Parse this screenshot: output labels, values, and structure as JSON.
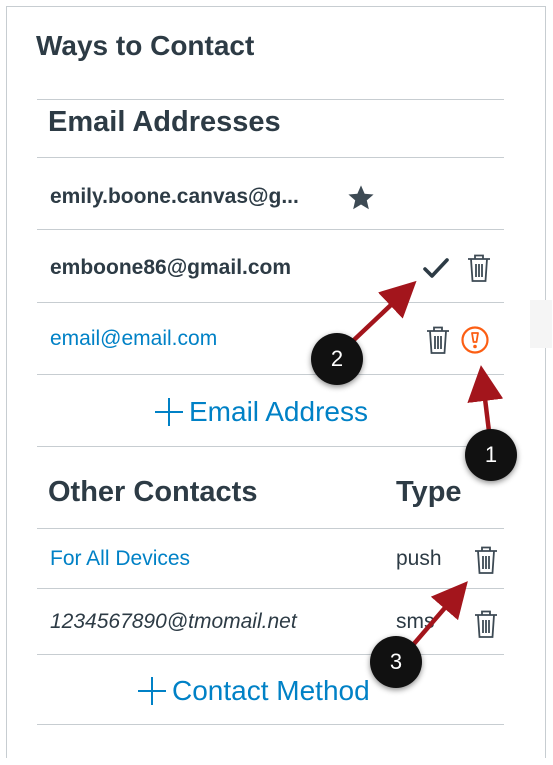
{
  "panel": {
    "title": "Ways to Contact"
  },
  "email_section": {
    "header": "Email Addresses",
    "items": [
      {
        "address": "emily.boone.canvas@g...",
        "status": "default",
        "icon": "star-icon"
      },
      {
        "address": "emboone86@gmail.com",
        "status": "confirmed",
        "icon": "checkmark-icon"
      },
      {
        "address": "email@email.com",
        "status": "unconfirmed",
        "icon": "alert-icon"
      }
    ],
    "add_label": "Email Address"
  },
  "other_section": {
    "header": "Other Contacts",
    "type_header": "Type",
    "items": [
      {
        "name": "For All Devices",
        "type": "push"
      },
      {
        "name": "1234567890@tmomail.net",
        "type": "sms"
      }
    ],
    "add_label": "Contact Method"
  },
  "callouts": [
    "1",
    "2",
    "3"
  ],
  "colors": {
    "link": "#0081c6",
    "alert": "#fc5e13",
    "callout_arrow": "#a3151c",
    "text": "#2d3b45"
  }
}
